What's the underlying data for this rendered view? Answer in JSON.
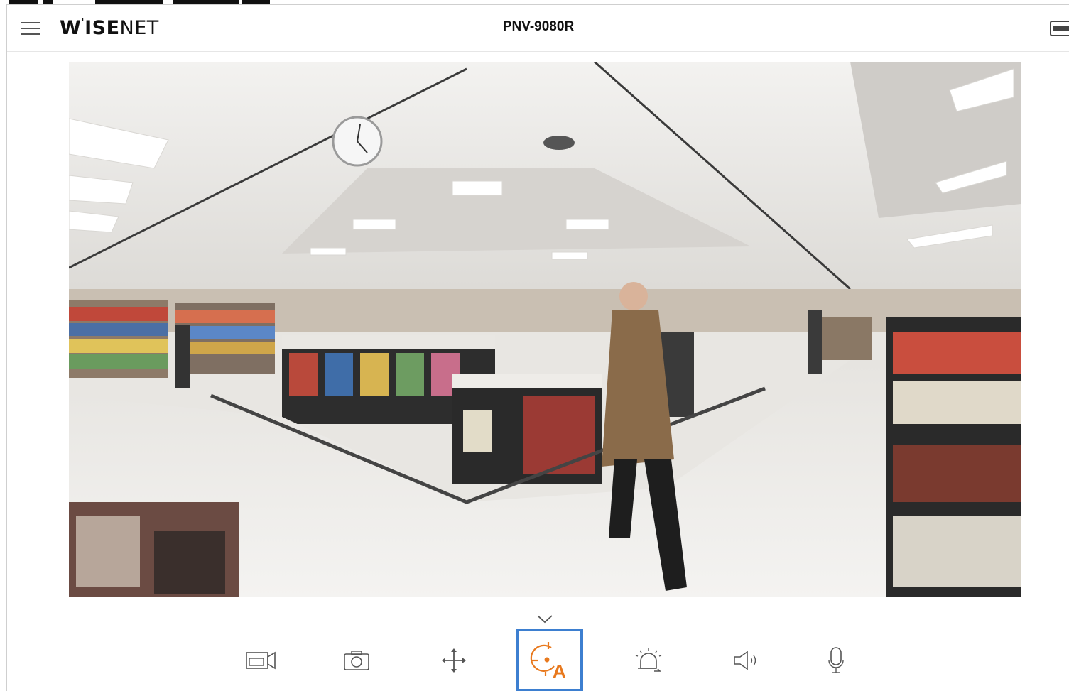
{
  "header": {
    "logo_text": "WISENET",
    "model_name": "PNV-9080R"
  },
  "icons": {
    "menu": "hamburger-menu-icon",
    "display": "display-mode-icon",
    "collapse": "chevron-down-icon",
    "record": "video-record-icon",
    "snapshot": "camera-snapshot-icon",
    "ptz": "ptz-move-icon",
    "auto_tracking": "auto-tracking-icon",
    "alarm": "alarm-output-icon",
    "audio": "speaker-icon",
    "mic": "microphone-icon"
  },
  "toolbar": {
    "active_tool": "auto_tracking",
    "active_color": "#3d7fd0",
    "accent_color": "#e8791e"
  }
}
